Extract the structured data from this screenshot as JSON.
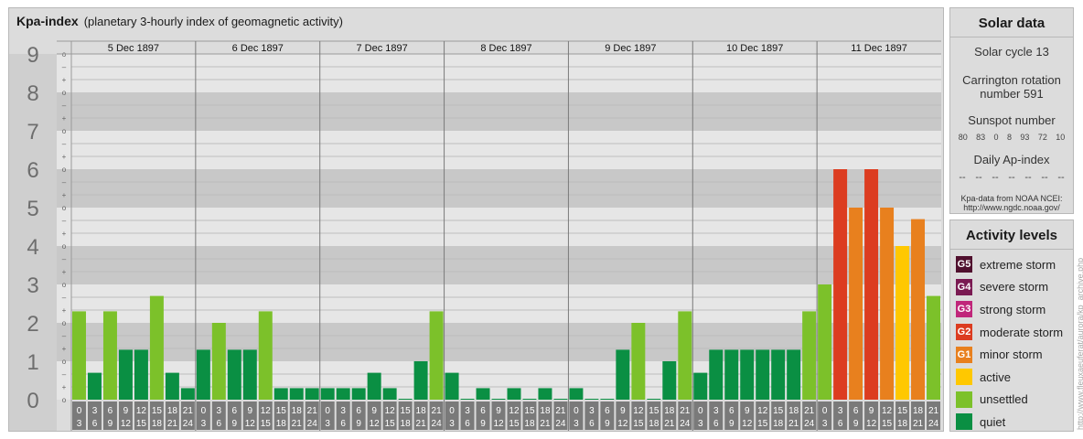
{
  "header": {
    "title": "Kpa-index",
    "subtitle": "(planetary 3-hourly index of geomagnetic activity)"
  },
  "colors": {
    "quiet": "#0a8f43",
    "unsettled": "#7cc12a",
    "active": "#ffc800",
    "minor_storm": "#e8801e",
    "moderate_storm": "#dc3c20",
    "strong_storm": "#c0267a",
    "severe_storm": "#7a1a52",
    "extreme_storm": "#50102e",
    "band_dark": "#c8c8c8",
    "band_light": "#e6e6e6"
  },
  "chart_data": {
    "type": "bar",
    "title": "Kpa-index",
    "ylim": [
      0,
      9
    ],
    "y_ticks": [
      "0",
      "1",
      "2",
      "3",
      "4",
      "5",
      "6",
      "7",
      "8",
      "9"
    ],
    "sub_ticks": [
      "–",
      "o",
      "+"
    ],
    "days": [
      {
        "date": "5 Dec 1897",
        "values": [
          2.3,
          0.7,
          2.3,
          1.3,
          1.3,
          2.7,
          0.7,
          0.3
        ]
      },
      {
        "date": "6 Dec 1897",
        "values": [
          1.3,
          2.0,
          1.3,
          1.3,
          2.3,
          0.3,
          0.3,
          0.3
        ]
      },
      {
        "date": "7 Dec 1897",
        "values": [
          0.3,
          0.3,
          0.3,
          0.7,
          0.3,
          0.0,
          1.0,
          2.3
        ]
      },
      {
        "date": "8 Dec 1897",
        "values": [
          0.7,
          0.0,
          0.3,
          0.0,
          0.3,
          0.0,
          0.3,
          0.0
        ]
      },
      {
        "date": "9 Dec 1897",
        "values": [
          0.3,
          0.0,
          0.0,
          1.3,
          2.0,
          0.0,
          1.0,
          2.3
        ]
      },
      {
        "date": "10 Dec 1897",
        "values": [
          0.7,
          1.3,
          1.3,
          1.3,
          1.3,
          1.3,
          1.3,
          2.3
        ]
      },
      {
        "date": "11 Dec 1897",
        "values": [
          3.0,
          6.0,
          5.0,
          6.0,
          5.0,
          4.0,
          4.7,
          2.7
        ]
      }
    ],
    "interval_labels": [
      [
        "0",
        "3"
      ],
      [
        "3",
        "6"
      ],
      [
        "6",
        "9"
      ],
      [
        "9",
        "12"
      ],
      [
        "12",
        "15"
      ],
      [
        "15",
        "18"
      ],
      [
        "18",
        "21"
      ],
      [
        "21",
        "24"
      ]
    ]
  },
  "solar_data": {
    "title": "Solar data",
    "solar_cycle": "Solar cycle 13",
    "carrington_line1": "Carrington rotation",
    "carrington_line2": "number 591",
    "sunspot_label": "Sunspot number",
    "sunspot_numbers": [
      "80",
      "83",
      "0",
      "8",
      "93",
      "72",
      "10"
    ],
    "ap_label": "Daily Ap-index",
    "ap_values": [
      "--",
      "--",
      "--",
      "--",
      "--",
      "--",
      "--"
    ],
    "source_line1": "Kpa-data from NOAA NCEI:",
    "source_line2": "http://www.ngdc.noaa.gov/"
  },
  "activity_levels": {
    "title": "Activity levels",
    "items": [
      {
        "code": "G5",
        "label": "extreme storm",
        "color": "#50102e"
      },
      {
        "code": "G4",
        "label": "severe storm",
        "color": "#7a1a52"
      },
      {
        "code": "G3",
        "label": "strong storm",
        "color": "#c0267a"
      },
      {
        "code": "G2",
        "label": "moderate storm",
        "color": "#dc3c20"
      },
      {
        "code": "G1",
        "label": "minor storm",
        "color": "#e8801e"
      },
      {
        "code": "",
        "label": "active",
        "color": "#ffc800"
      },
      {
        "code": "",
        "label": "unsettled",
        "color": "#7cc12a"
      },
      {
        "code": "",
        "label": "quiet",
        "color": "#0a8f43"
      }
    ]
  },
  "credit": "http://www.fleuxaeuferat/aurora/kp_archive.php"
}
